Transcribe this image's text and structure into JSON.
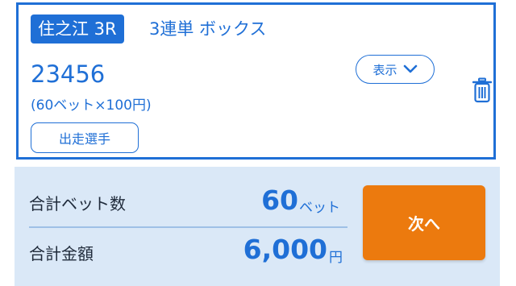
{
  "ticket": {
    "venue_race": "住之江 3R",
    "bet_type": "3連単 ボックス",
    "combination": "23456",
    "bet_info": "(60ベット×100円)",
    "players_button": "出走選手",
    "display_button": "表示",
    "delete_icon": "trash-icon"
  },
  "summary": {
    "total_bets_label": "合計ベット数",
    "total_bets_value": "60",
    "total_bets_unit": "ベット",
    "total_amount_label": "合計金額",
    "total_amount_value": "6,000",
    "total_amount_unit": "円",
    "next_button": "次へ"
  },
  "colors": {
    "accent": "#1f6fd6",
    "summary_bg": "#dae8f7",
    "next_button": "#ec7a0e"
  }
}
